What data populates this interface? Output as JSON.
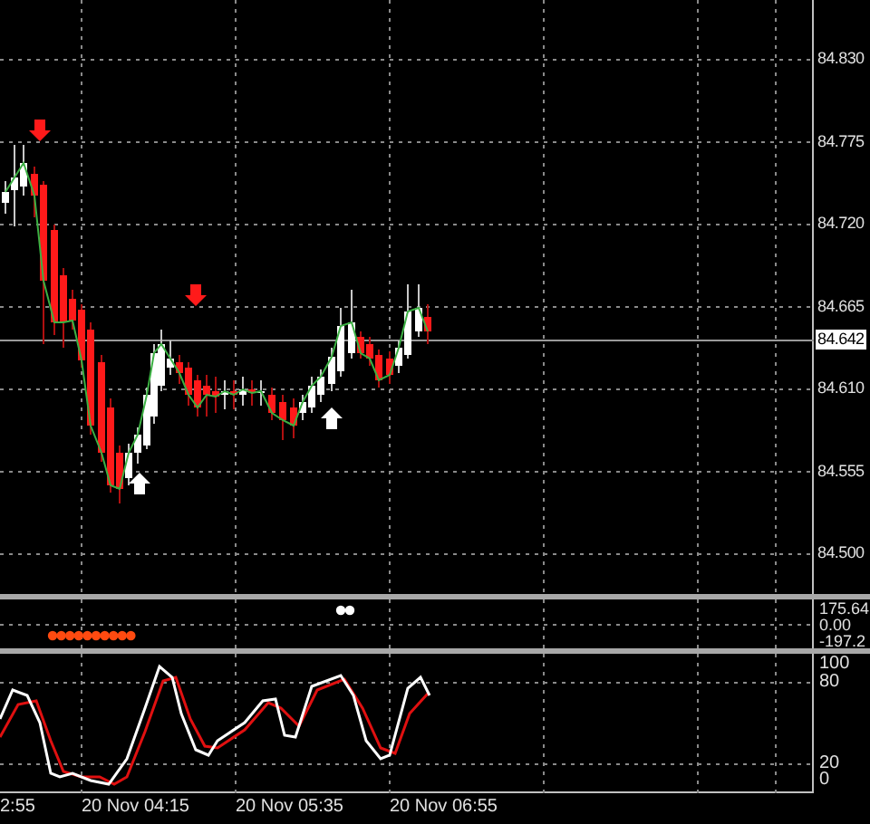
{
  "price_axis": {
    "labels": [
      "84.830",
      "84.775",
      "84.720",
      "84.665",
      "84.610",
      "84.555",
      "84.500"
    ],
    "current_price": "84.642"
  },
  "indicator_axis": {
    "labels": [
      "175.64",
      "0.00",
      "-197.2"
    ]
  },
  "stochastic_axis": {
    "labels": [
      "100",
      "80",
      "20",
      "0"
    ]
  },
  "time_axis": {
    "labels": [
      "2:55",
      "20 Nov 04:15",
      "20 Nov 05:35",
      "20 Nov 06:55"
    ]
  }
}
